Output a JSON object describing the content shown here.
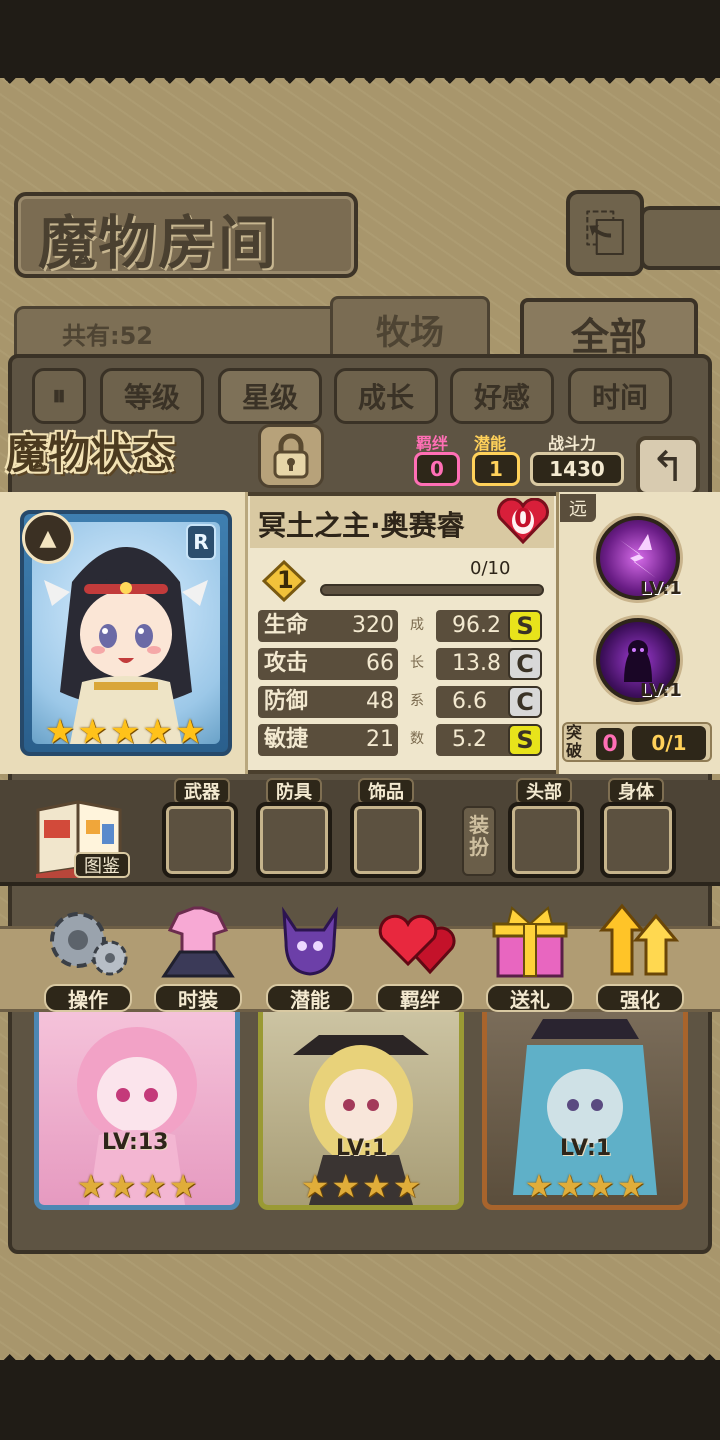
{
  "header": {
    "title": "魔物房间",
    "count_label": "共有:52",
    "tabs": [
      {
        "label": "牧场",
        "active": false
      },
      {
        "label": "全部",
        "active": true
      }
    ]
  },
  "sort": {
    "toggle_icon": "sort-toggle-icon",
    "options": [
      "等级",
      "星级",
      "成长",
      "好感",
      "时间"
    ],
    "selected": "星级"
  },
  "status": {
    "title": "魔物状态",
    "bond_label": "羁绊",
    "bond_value": "0",
    "potential_label": "潜能",
    "potential_value": "1",
    "power_label": "战斗力",
    "power_value": "1430"
  },
  "monster": {
    "name": "冥土之主·奥赛睿",
    "rank": "R",
    "affection": "0",
    "level": "1",
    "exp": "0/10",
    "exp_fraction": 0,
    "stars": 5,
    "stats": [
      {
        "name": "生命",
        "value": "320",
        "growth": "96.2",
        "grade": "S"
      },
      {
        "name": "攻击",
        "value": "66",
        "growth": "13.8",
        "grade": "C"
      },
      {
        "name": "防御",
        "value": "48",
        "growth": "6.6",
        "grade": "C"
      },
      {
        "name": "敏捷",
        "value": "21",
        "growth": "5.2",
        "grade": "S"
      }
    ],
    "growth_label_chars": [
      "成",
      "长",
      "系",
      "数"
    ],
    "range": "远",
    "skills": [
      {
        "icon": "lightning-skill-icon",
        "level": "LV:1"
      },
      {
        "icon": "shadow-skill-icon",
        "level": "LV:1"
      }
    ],
    "breakthrough_label": "突破",
    "breakthrough_count": "0",
    "breakthrough_progress": "0/1"
  },
  "equipment": {
    "codex_label": "图鉴",
    "dressup_label": "装扮",
    "slots": [
      "武器",
      "防具",
      "饰品",
      "头部",
      "身体"
    ]
  },
  "actions": [
    {
      "label": "操作",
      "icon": "gear-icon"
    },
    {
      "label": "时装",
      "icon": "outfit-icon"
    },
    {
      "label": "潜能",
      "icon": "demon-icon"
    },
    {
      "label": "羁绊",
      "icon": "hearts-icon"
    },
    {
      "label": "送礼",
      "icon": "gift-icon"
    },
    {
      "label": "强化",
      "icon": "upgrade-arrows-icon"
    }
  ],
  "roster": [
    {
      "level": "LV:13",
      "stars": 4,
      "color": "#4d87b3"
    },
    {
      "level": "LV:1",
      "stars": 4,
      "color": "#9a9a34"
    },
    {
      "level": "LV:1",
      "stars": 4,
      "color": "#a8642c"
    }
  ],
  "colors": {
    "bond": "#ff6fb5",
    "potential": "#ffd15a",
    "grade_s": "#e8e31b",
    "grade_c": "#d8d8d8"
  }
}
